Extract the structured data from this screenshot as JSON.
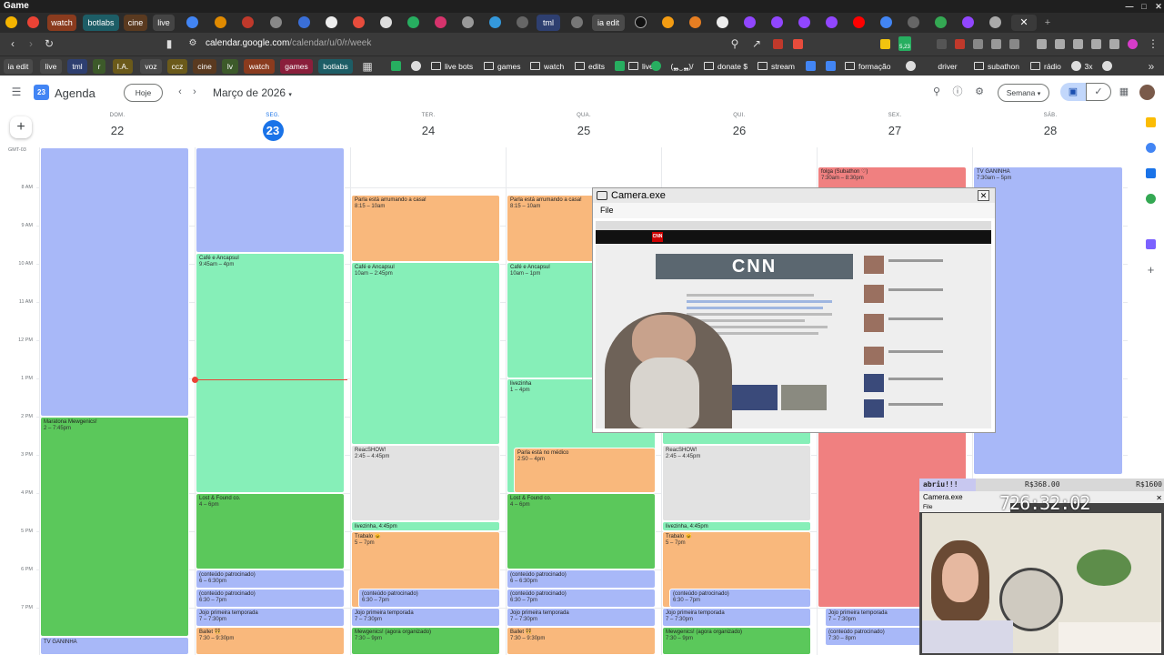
{
  "window": {
    "title": "Game"
  },
  "tabs": {
    "labels": [
      "watch",
      "botlabs",
      "cine",
      "live",
      "tml",
      "ia edit"
    ]
  },
  "address": {
    "domain": "calendar.google.com",
    "path": "/calendar/u/0/r/week",
    "ext_badge": "5,23"
  },
  "bookmarks": {
    "chips": [
      "ia edit",
      "live",
      "tml",
      "r",
      "I.A.",
      "voz",
      "ccz",
      "cine",
      "lv",
      "watch",
      "games",
      "botlabs"
    ],
    "folders": [
      "live bots",
      "games",
      "watch",
      "edits",
      "lives",
      "(❠‿❠)/",
      "donate $",
      "stream",
      "formação",
      "driver",
      "subathon",
      "rádio",
      "3x"
    ]
  },
  "calendar": {
    "app_name": "Agenda",
    "logo_text": "23",
    "today_label": "Hoje",
    "month_label": "Março de 2026",
    "view_label": "Semana",
    "timezone": "GMT-03",
    "days": [
      {
        "dow": "DOM.",
        "num": "22"
      },
      {
        "dow": "SEG.",
        "num": "23"
      },
      {
        "dow": "TER.",
        "num": "24"
      },
      {
        "dow": "QUA.",
        "num": "25"
      },
      {
        "dow": "QUI.",
        "num": "26"
      },
      {
        "dow": "SEX.",
        "num": "27"
      },
      {
        "dow": "SÁB.",
        "num": "28"
      }
    ],
    "hours": [
      "8 AM",
      "9 AM",
      "10 AM",
      "11 AM",
      "12 PM",
      "1 PM",
      "2 PM",
      "3 PM",
      "4 PM",
      "5 PM",
      "6 PM",
      "7 PM"
    ],
    "events": {
      "sun_maratona": {
        "title": "Maratona Mewgenics!",
        "time": "2 – 7:45pm"
      },
      "sun_tv": {
        "title": "TV GANINHA",
        "time": ""
      },
      "mon_cafe": {
        "title": "Café e Ancapsul",
        "time": "9:45am – 4pm"
      },
      "mon_lost": {
        "title": "Lost & Found co.",
        "time": "4 – 6pm"
      },
      "mon_patro1": {
        "title": "(conteúdo patrocinado)",
        "time": "6 – 6:30pm"
      },
      "mon_patro2": {
        "title": "(conteúdo patrocinado)",
        "time": "6:30 – 7pm"
      },
      "mon_jojo": {
        "title": "Jojo primeira temporada",
        "time": "7 – 7:30pm"
      },
      "mon_ballet": {
        "title": "Ballet 👯",
        "time": "7:30 – 9:30pm"
      },
      "tue_parla": {
        "title": "Parla está arrumando a casa!",
        "time": "8:15 – 10am"
      },
      "tue_cafe": {
        "title": "Café e Ancapsul",
        "time": "10am – 2:45pm"
      },
      "tue_react": {
        "title": "ReacSHOW!",
        "time": "2:45 – 4:45pm"
      },
      "tue_live": {
        "title": "livezinha, 4:45pm",
        "time": ""
      },
      "tue_trab": {
        "title": "Trabalo 😺",
        "time": "5 – 7pm"
      },
      "tue_patro": {
        "title": "(conteúdo patrocinado)",
        "time": "6:30 – 7pm"
      },
      "tue_jojo": {
        "title": "Jojo primeira temporada",
        "time": "7 – 7:30pm"
      },
      "tue_mew": {
        "title": "Mewgenics! (agora organizado)",
        "time": "7:30 – 9pm"
      },
      "wed_parla": {
        "title": "Parla está arrumando a casa!",
        "time": "8:15 – 10am"
      },
      "wed_cafe": {
        "title": "Café e Ancapsul",
        "time": "10am – 1pm"
      },
      "wed_live": {
        "title": "livezinha",
        "time": "1 – 4pm"
      },
      "wed_medico": {
        "title": "Parla está no médico",
        "time": "2:50 – 4pm"
      },
      "wed_lost": {
        "title": "Lost & Found co.",
        "time": "4 – 6pm"
      },
      "wed_patro1": {
        "title": "(conteúdo patrocinado)",
        "time": "6 – 6:30pm"
      },
      "wed_patro2": {
        "title": "(conteúdo patrocinado)",
        "time": "6:30 – 7pm"
      },
      "wed_jojo": {
        "title": "Jojo primeira temporada",
        "time": "7 – 7:30pm"
      },
      "wed_ballet": {
        "title": "Ballet 👯",
        "time": "7:30 – 9:30pm"
      },
      "thu_react": {
        "title": "ReacSHOW!",
        "time": "2:45 – 4:45pm"
      },
      "thu_live": {
        "title": "livezinha, 4:45pm",
        "time": ""
      },
      "thu_trab": {
        "title": "Trabalo 😺",
        "time": "5 – 7pm"
      },
      "thu_patro": {
        "title": "(conteúdo patrocinado)",
        "time": "6:30 – 7pm"
      },
      "thu_jojo": {
        "title": "Jojo primeira temporada",
        "time": "7 – 7:30pm"
      },
      "thu_mew": {
        "title": "Mewgenics! (agora organizado)",
        "time": "7:30 – 9pm"
      },
      "fri_folga": {
        "title": "folga (Subathon ♡)",
        "time": "7:30am – 8:30pm"
      },
      "fri_jojo": {
        "title": "Jojo primeira temporada",
        "time": "7 – 7:30pm"
      },
      "fri_patro": {
        "title": "(conteúdo patrocinado)",
        "time": "7:30 – 8pm"
      },
      "sat_tv": {
        "title": "TV GANINHA",
        "time": "7:30am – 5pm"
      }
    }
  },
  "camera_window": {
    "title": "Camera.exe",
    "menu": "File",
    "site_logo": "CNN",
    "hero_text": "CNN"
  },
  "overlay": {
    "goal_label": "abriu!!!",
    "goal_progress": 0.23,
    "goal_current": "R$368.00",
    "goal_target": "R$1600",
    "cam_title": "Camera.exe",
    "cam_menu": "File",
    "timer": "726:32:02"
  },
  "colors": {
    "blue": "#a8b8f8",
    "peach": "#f9b87c",
    "mint": "#86efb8",
    "green": "#5bc85b",
    "gray": "#e2e2e2",
    "red": "#f08080",
    "accent": "#1a73e8"
  }
}
